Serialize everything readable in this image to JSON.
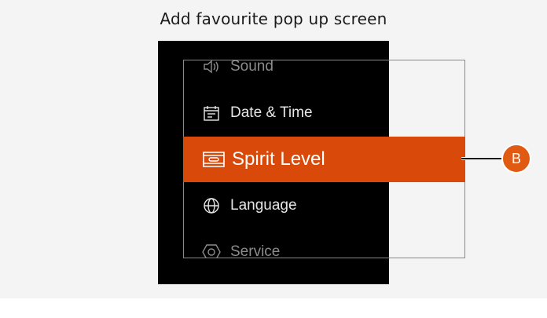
{
  "header": {
    "title": "Add favourite pop up screen"
  },
  "menu": {
    "items": [
      {
        "label": "Sound",
        "icon": "speaker-icon",
        "state": "faded"
      },
      {
        "label": "Date & Time",
        "icon": "calendar-icon",
        "state": "normal"
      },
      {
        "label": "Spirit Level",
        "icon": "spirit-level-icon",
        "state": "selected"
      },
      {
        "label": "Language",
        "icon": "globe-icon",
        "state": "normal"
      },
      {
        "label": "Service",
        "icon": "hexagon-icon",
        "state": "faded"
      }
    ]
  },
  "callout": {
    "label": "B",
    "color": "#e05a12"
  },
  "colors": {
    "accent": "#d94a0a",
    "screen": "#000000",
    "text": "#e6e6e6",
    "faded": "#8c8c8c"
  }
}
